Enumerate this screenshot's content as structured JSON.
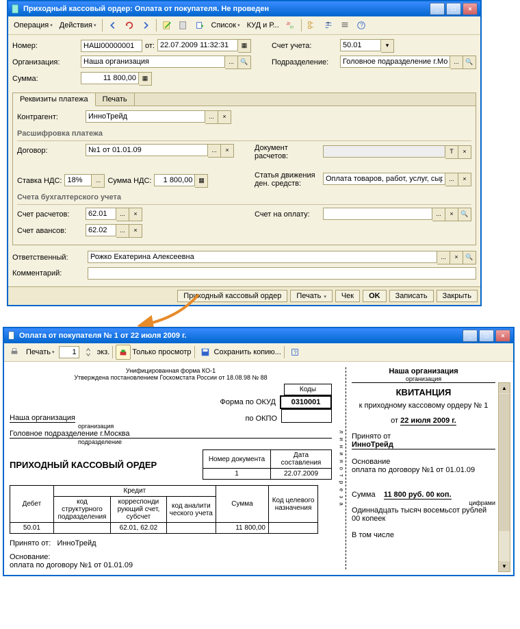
{
  "win1": {
    "title": "Приходный кассовый ордер: Оплата от покупателя. Не проведен",
    "menu": {
      "operation": "Операция",
      "actions": "Действия",
      "list": "Список",
      "kud": "КУД и Р..."
    },
    "labels": {
      "number": "Номер:",
      "from": "от:",
      "account": "Счет учета:",
      "org": "Организация:",
      "dept": "Подразделение:",
      "sum": "Сумма:",
      "contractor": "Контрагент:",
      "contract": "Договор:",
      "calcDoc": "Документ расчетов:",
      "vatRate": "Ставка НДС:",
      "vatSum": "Сумма НДС:",
      "dds": "Статья движения ден. средств:",
      "accCalc": "Счет расчетов:",
      "accInvoice": "Счет на оплату:",
      "accAdv": "Счет авансов:",
      "responsible": "Ответственный:",
      "comment": "Комментарий:"
    },
    "sections": {
      "decode": "Расшифровка платежа",
      "accounting": "Счета бухгалтерского учета"
    },
    "tabs": {
      "requisites": "Реквизиты платежа",
      "print": "Печать"
    },
    "values": {
      "number": "НАШ00000001",
      "date": "22.07.2009 11:32:31",
      "account": "50.01",
      "org": "Наша организация",
      "dept": "Головное подразделение г.Москва",
      "sum": "11 800,00",
      "contractor": "ИнноТрейд",
      "contract": "№1 от 01.01.09",
      "vatRate": "18%",
      "vatSum": "1 800,00",
      "dds": "Оплата товаров, работ, услуг, сырь",
      "accCalc": "62.01",
      "accAdv": "62.02",
      "responsible": "Рожко Екатерина Алексеевна"
    },
    "footer": {
      "pko": "Приходный кассовый ордер",
      "print": "Печать",
      "check": "Чек",
      "ok": "OK",
      "save": "Записать",
      "close": "Закрыть"
    }
  },
  "win2": {
    "title": "Оплата от покупателя № 1 от 22 июля 2009 г.",
    "toolbar": {
      "print": "Печать",
      "copies": "1",
      "ekz": "экз.",
      "viewOnly": "Только просмотр",
      "saveCopy": "Сохранить копию..."
    },
    "form": {
      "header1": "Унифицированная форма КО-1",
      "header2": "Утверждена постановлением Госкомстата России от 18.08.98 № 88",
      "codesLabel": "Коды",
      "okud": "Форма по ОКУД",
      "okudCode": "0310001",
      "okpo": "по ОКПО",
      "org": "Наша организация",
      "orgLbl": "организация",
      "dept": "Головное подразделение г.Москва",
      "deptLbl": "подразделение",
      "title": "ПРИХОДНЫЙ КАССОВЫЙ ОРДЕР",
      "docNumLbl": "Номер документа",
      "docNum": "1",
      "docDateLbl": "Дата составления",
      "docDate": "22.07.2009",
      "tbl": {
        "debit": "Дебет",
        "credit": "Кредит",
        "kodStruct": "код структурного подразделения",
        "korr": "корреспонди рующий счет, субсчет",
        "kodAnalytic": "код аналити ческого учета",
        "sum": "Сумма",
        "kodTarget": "Код целевого назначения",
        "debitVal": "50.01",
        "korrVal": "62.01, 62.02",
        "sumVal": "11 800,00"
      },
      "acceptedLbl": "Принято от:",
      "accepted": "ИнноТрейд",
      "basisLbl": "Основание:",
      "basis": "оплата по договору №1 от 01.01.09"
    },
    "receipt": {
      "org": "Наша организация",
      "orgLbl": "организация",
      "title": "КВИТАНЦИЯ",
      "sub": "к приходному кассовому ордеру № 1",
      "dateLbl": "от",
      "date": "22 июля 2009 г.",
      "acceptedLbl": "Принято от",
      "accepted": "ИнноТрейд",
      "basisLbl": "Основание",
      "basis": "оплата по договору №1 от 01.01.09",
      "sumLbl": "Сумма",
      "sum": "11 800 руб. 00 коп.",
      "sumFootnote": "цифрами",
      "sumWords": "Одиннадцать тысяч восемьсот рублей 00 копеек",
      "incl": "В том числе",
      "cut": "л и н и я   о т р е з а"
    }
  }
}
